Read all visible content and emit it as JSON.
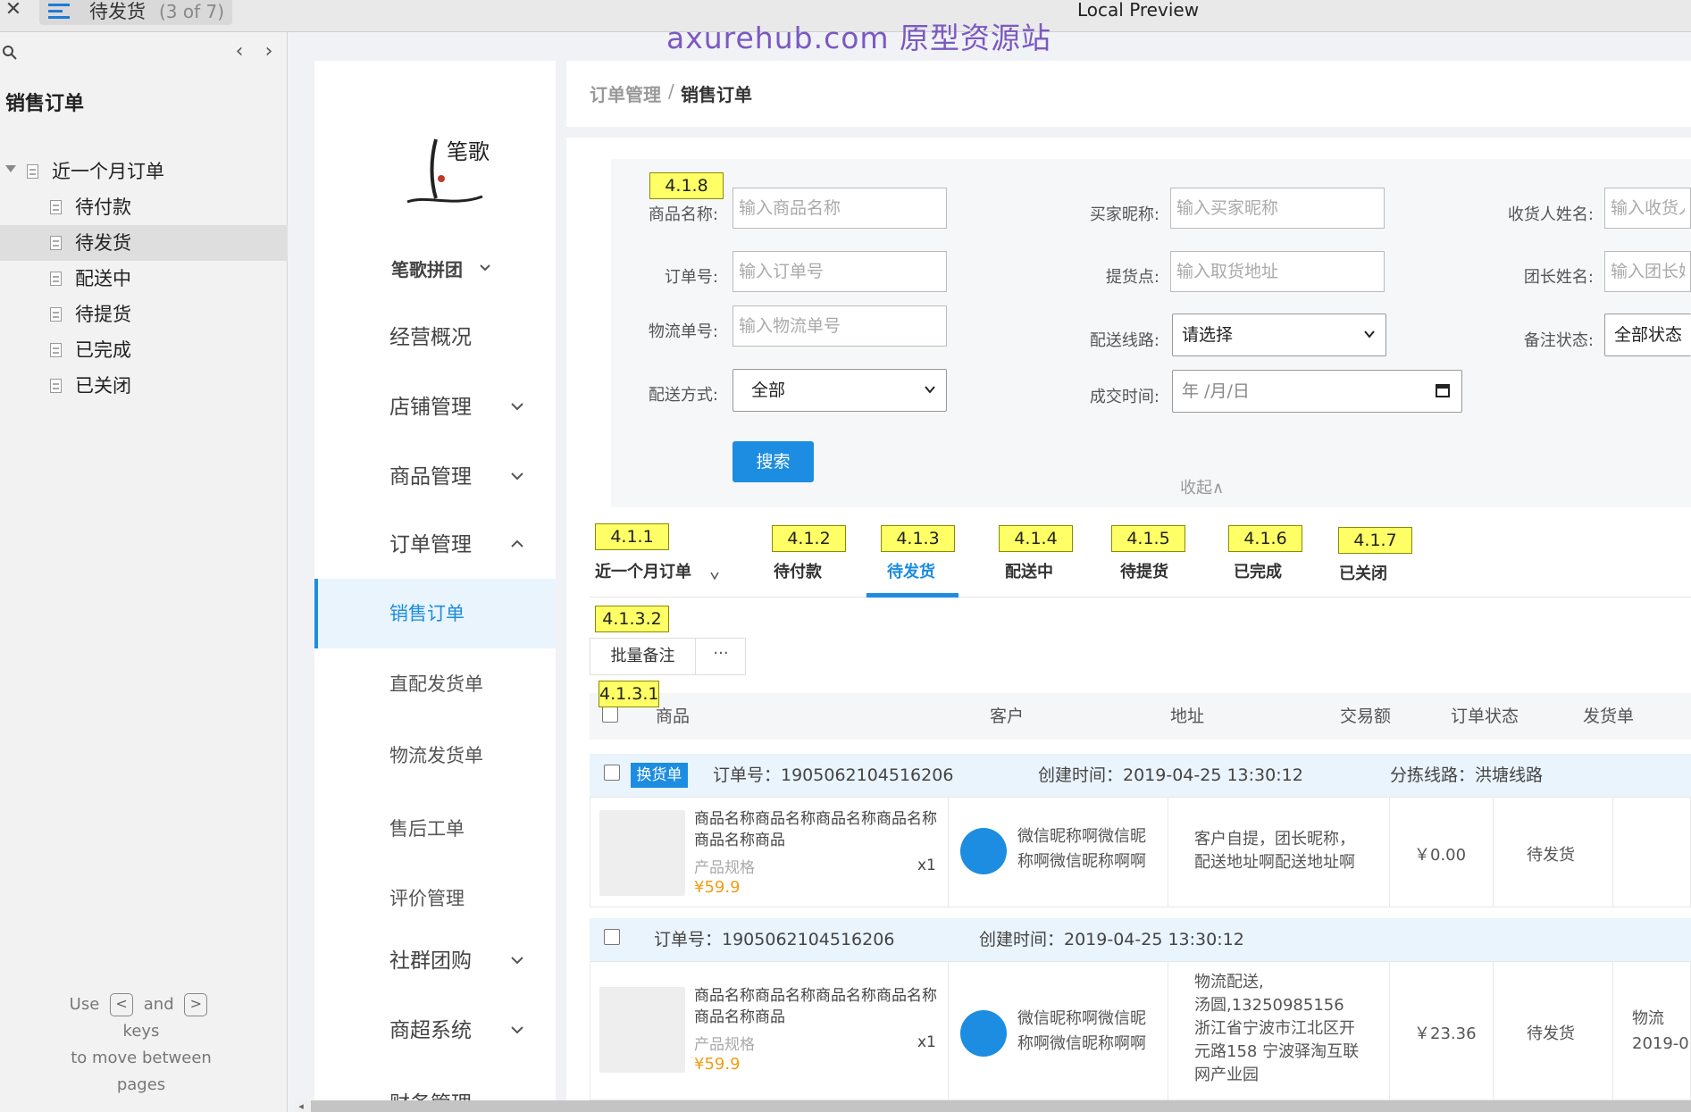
{
  "topbar": {
    "page_name": "待发货",
    "page_count": "(3 of 7)",
    "window_title": "Local Preview",
    "watermark": "axurehub.com 原型资源站"
  },
  "left_panel": {
    "heading": "销售订单",
    "tree": [
      {
        "label": "近一个月订单"
      },
      {
        "label": "待付款"
      },
      {
        "label": "待发货"
      },
      {
        "label": "配送中"
      },
      {
        "label": "待提货"
      },
      {
        "label": "已完成"
      },
      {
        "label": "已关闭"
      }
    ],
    "help_use": "Use",
    "help_and": "and",
    "help_rest1": "keys",
    "help_rest2": "to move between",
    "help_rest3": "pages",
    "key_prev": "<",
    "key_next": ">"
  },
  "nav": {
    "brand": "笔歌拼团",
    "logo_text": "笔歌",
    "items": [
      {
        "label": "经营概况"
      },
      {
        "label": "店铺管理"
      },
      {
        "label": "商品管理"
      },
      {
        "label": "订单管理"
      },
      {
        "label": "销售订单"
      },
      {
        "label": "直配发货单"
      },
      {
        "label": "物流发货单"
      },
      {
        "label": "售后工单"
      },
      {
        "label": "评价管理"
      },
      {
        "label": "社群团购"
      },
      {
        "label": "商超系统"
      },
      {
        "label": "财务管理"
      }
    ]
  },
  "breadcrumb": {
    "parent": "订单管理",
    "separator": "/",
    "current": "销售订单"
  },
  "filters": {
    "product_name": {
      "label": "商品名称:",
      "placeholder": "输入商品名称"
    },
    "buyer_nick": {
      "label": "买家昵称:",
      "placeholder": "输入买家昵称"
    },
    "receiver_name": {
      "label": "收货人姓名:",
      "placeholder": "输入收货人"
    },
    "order_no": {
      "label": "订单号:",
      "placeholder": "输入订单号"
    },
    "pickup_point": {
      "label": "提货点:",
      "placeholder": "输入取货地址"
    },
    "leader_name": {
      "label": "团长姓名:",
      "placeholder": "输入团长姓"
    },
    "logistics_no": {
      "label": "物流单号:",
      "placeholder": "输入物流单号"
    },
    "delivery_route": {
      "label": "配送线路:",
      "value": "请选择"
    },
    "remark_status": {
      "label": "备注状态:",
      "value": "全部状态"
    },
    "delivery_method": {
      "label": "配送方式:",
      "value": "全部"
    },
    "deal_time": {
      "label": "成交时间:",
      "value": "年 /月/日"
    },
    "search_button": "搜索",
    "collapse": "收起∧"
  },
  "annotations": {
    "filters": "4.1.8",
    "tab_recent": "4.1.1",
    "tab_unpaid": "4.1.2",
    "tab_to_ship": "4.1.3",
    "tab_shipping": "4.1.4",
    "tab_pickup": "4.1.5",
    "tab_done": "4.1.6",
    "tab_closed": "4.1.7",
    "bulk_actions": "4.1.3.2",
    "table": "4.1.3.1"
  },
  "tabs": [
    {
      "label": "近一个月订单"
    },
    {
      "label": "待付款"
    },
    {
      "label": "待发货",
      "active": true
    },
    {
      "label": "配送中"
    },
    {
      "label": "待提货"
    },
    {
      "label": "已完成"
    },
    {
      "label": "已关闭"
    }
  ],
  "actions": {
    "bulk_remark": "批量备注",
    "more": "···"
  },
  "table": {
    "headers": [
      "商品",
      "客户",
      "地址",
      "交易额",
      "订单状态",
      "发货单"
    ],
    "orders": [
      {
        "badge": "换货单",
        "order_no": "订单号：1905062104516206",
        "created": "创建时间：2019-04-25 13:30:12",
        "route": "分拣线路：洪塘线路",
        "product_name": "商品名称商品名称商品名称商品名称商品名称商品",
        "spec": "产品规格",
        "qty": "x1",
        "price": "¥59.9",
        "customer": "微信昵称啊微信昵称啊微信昵称啊啊",
        "address_lines": [
          "客户自提，团长昵称，",
          "配送地址啊配送地址啊"
        ],
        "amount": "￥0.00",
        "status": "待发货",
        "ship_lines": [
          "",
          ""
        ]
      },
      {
        "badge": "",
        "order_no": "订单号：1905062104516206",
        "created": "创建时间：2019-04-25 13:30:12",
        "route": "",
        "product_name": "商品名称商品名称商品名称商品名称商品名称商品",
        "spec": "产品规格",
        "qty": "x1",
        "price": "¥59.9",
        "customer": "微信昵称啊微信昵称啊微信昵称啊啊",
        "address_lines": [
          "物流配送,",
          "汤圆,13250985156",
          "浙江省宁波市江北区开",
          "元路158 宁波驿淘互联",
          "网产业园"
        ],
        "amount": "￥23.36",
        "status": "待发货",
        "ship_lines": [
          "物流",
          "2019-0"
        ]
      }
    ]
  }
}
